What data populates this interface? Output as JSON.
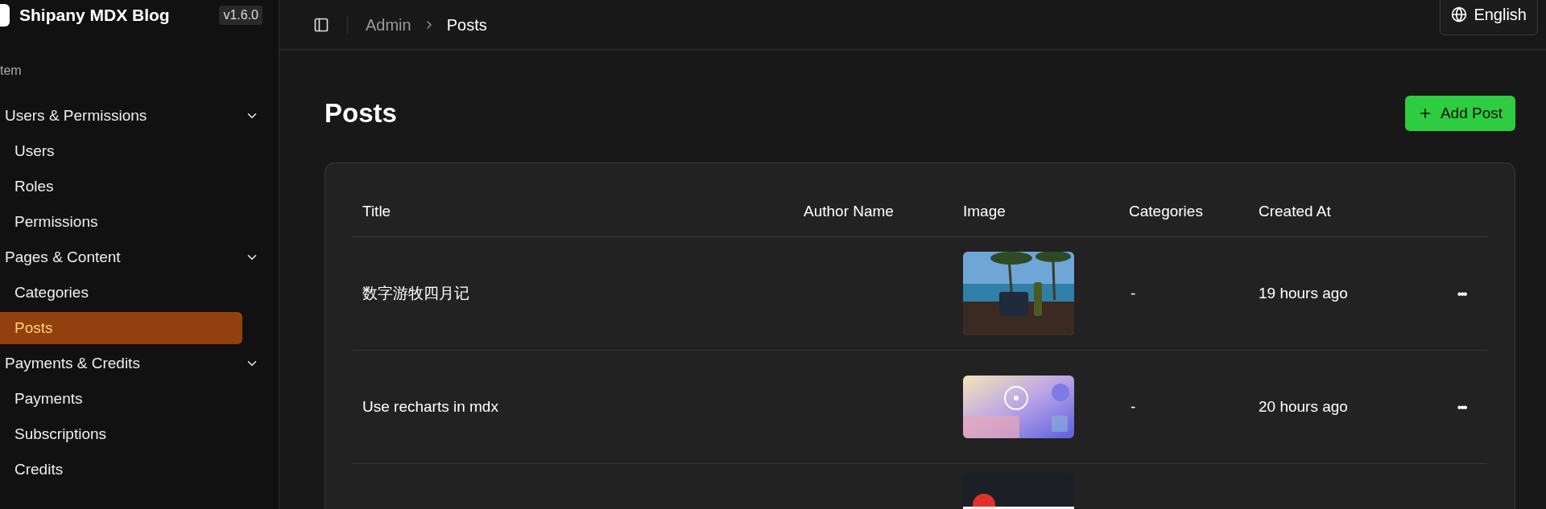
{
  "sidebar": {
    "brand": "Shipany MDX Blog",
    "version": "v1.6.0",
    "section_label": "tem",
    "groups": [
      {
        "label": "Users & Permissions",
        "expanded": true,
        "items": [
          {
            "label": "Users",
            "selected": false
          },
          {
            "label": "Roles",
            "selected": false
          },
          {
            "label": "Permissions",
            "selected": false
          }
        ]
      },
      {
        "label": "Pages & Content",
        "expanded": true,
        "items": [
          {
            "label": "Categories",
            "selected": false
          },
          {
            "label": "Posts",
            "selected": true
          }
        ]
      },
      {
        "label": "Payments & Credits",
        "expanded": true,
        "items": [
          {
            "label": "Payments",
            "selected": false
          },
          {
            "label": "Subscriptions",
            "selected": false
          },
          {
            "label": "Credits",
            "selected": false
          }
        ]
      }
    ]
  },
  "topbar": {
    "breadcrumbs": [
      "Admin",
      "Posts"
    ],
    "language": "English"
  },
  "page": {
    "title": "Posts",
    "add_button": "Add Post"
  },
  "table": {
    "columns": [
      "Title",
      "Author Name",
      "Image",
      "Categories",
      "Created At"
    ],
    "rows": [
      {
        "title": "数字游牧四月记",
        "image": {
          "kind": "picture"
        },
        "categories": "-",
        "created_at": "19 hours ago",
        "actions": "•••"
      },
      {
        "title": "Use recharts in mdx",
        "image": {
          "kind": "picture"
        },
        "categories": "-",
        "created_at": "20 hours ago",
        "actions": "•••"
      },
      {
        "image": {
          "kind": "picture"
        }
      }
    ]
  }
}
